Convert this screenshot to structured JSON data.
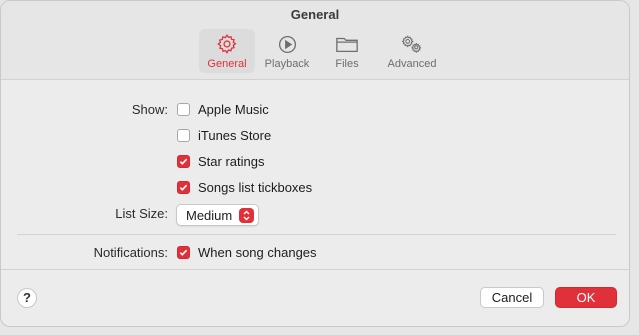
{
  "window": {
    "title": "General"
  },
  "tabs": [
    {
      "label": "General",
      "icon": "gear-icon",
      "active": true
    },
    {
      "label": "Playback",
      "icon": "play-circle-icon",
      "active": false
    },
    {
      "label": "Files",
      "icon": "folder-icon",
      "active": false
    },
    {
      "label": "Advanced",
      "icon": "gears-icon",
      "active": false
    }
  ],
  "show": {
    "label": "Show:",
    "options": [
      {
        "label": "Apple Music",
        "checked": false
      },
      {
        "label": "iTunes Store",
        "checked": false
      },
      {
        "label": "Star ratings",
        "checked": true
      },
      {
        "label": "Songs list tickboxes",
        "checked": true
      }
    ]
  },
  "list_size": {
    "label": "List Size:",
    "value": "Medium"
  },
  "notifications": {
    "label": "Notifications:",
    "option": {
      "label": "When song changes",
      "checked": true
    }
  },
  "footer": {
    "help_label": "?",
    "cancel_label": "Cancel",
    "ok_label": "OK"
  },
  "colors": {
    "accent": "#e0313b"
  }
}
